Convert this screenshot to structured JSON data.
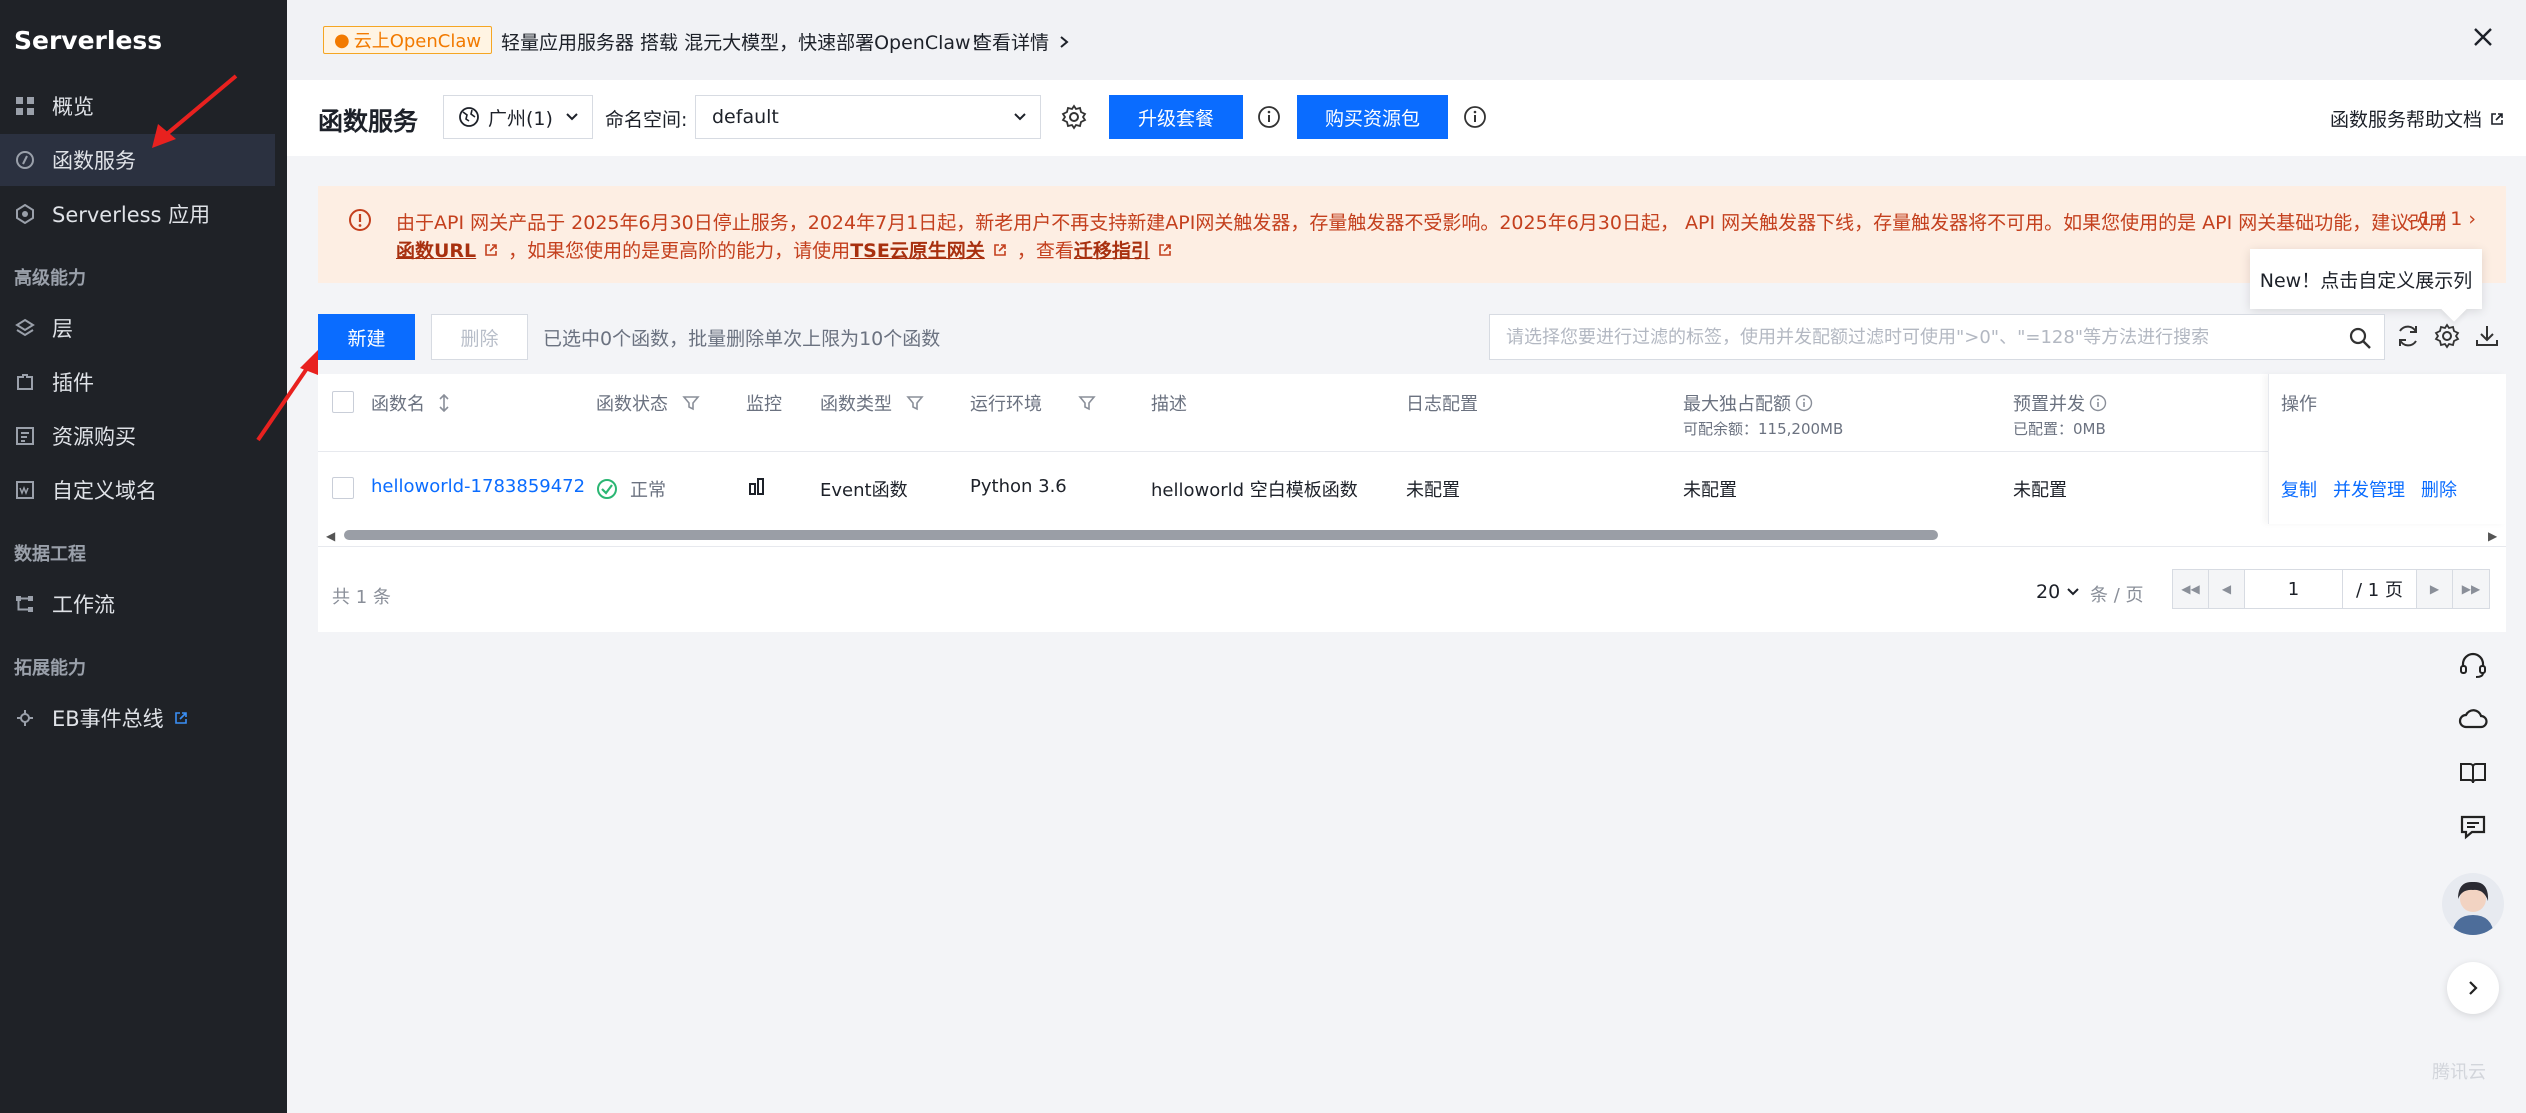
{
  "sidebar": {
    "title": "Serverless",
    "items": [
      {
        "label": "概览"
      },
      {
        "label": "函数服务"
      },
      {
        "label": "Serverless 应用"
      },
      {
        "label": "层"
      },
      {
        "label": "插件"
      },
      {
        "label": "资源购买"
      },
      {
        "label": "自定义域名"
      },
      {
        "label": "工作流"
      },
      {
        "label": "EB事件总线"
      }
    ],
    "sections": [
      "高级能力",
      "数据工程",
      "拓展能力"
    ]
  },
  "banner": {
    "tag": "云上OpenClaw",
    "text": "轻量应用服务器 搭载 混元大模型，快速部署OpenClaw！",
    "link": "查看详情"
  },
  "header": {
    "title": "函数服务",
    "region": "广州(1)",
    "namespace_label": "命名空间:",
    "namespace_value": "default",
    "upgrade_button": "升级套餐",
    "buy_button": "购买资源包",
    "help_link": "函数服务帮助文档"
  },
  "notice": {
    "line1": "由于API 网关产品于 2025年6月30日停止服务，2024年7月1日起，新老用户不再支持新建API网关触发器，存量触发器不受影响。2025年6月30日起， API 网关触发器下线，存量触发器将不可用。如果您使用的是 API 网关基础功能，建议改用",
    "link1": "函数URL",
    "mid": "，如果您使用的是更高阶的能力，请使用",
    "link2": "TSE云原生网关",
    "mid2": "，查看",
    "link3": "迁移指引",
    "pager": "1 / 1"
  },
  "tooltip": "New！点击自定义展示列",
  "toolbar": {
    "new_button": "新建",
    "delete_button": "删除",
    "selection_hint": "已选中0个函数，批量删除单次上限为10个函数",
    "search_placeholder": "请选择您要进行过滤的标签，使用并发配额过滤时可使用\">0\"、\"=128\"等方法进行搜索"
  },
  "table": {
    "columns": {
      "name": "函数名",
      "status": "函数状态",
      "monitor": "监控",
      "type": "函数类型",
      "runtime": "运行环境",
      "desc": "描述",
      "log": "日志配置",
      "quota": "最大独占配额",
      "quota_sub": "可配余额：115,200MB",
      "concurrency": "预置并发",
      "concurrency_sub": "已配置：0MB",
      "ops": "操作"
    },
    "rows": [
      {
        "name": "helloworld-1783859472",
        "status": "正常",
        "type": "Event函数",
        "runtime": "Python 3.6",
        "desc": "helloworld 空白模板函数",
        "log": "未配置",
        "quota": "未配置",
        "concurrency": "未配置",
        "ops": [
          "复制",
          "并发管理",
          "删除"
        ]
      }
    ],
    "total": "共 1 条",
    "page_size": "20",
    "page_size_unit": "条 / 页",
    "current_page": "1",
    "total_pages": "/ 1 页"
  },
  "watermark": "腾讯云",
  "colors": {
    "primary": "#0a6cff",
    "sidebar_bg": "#1f2227",
    "notice_bg": "#fdeee3",
    "notice_text": "#c4401e"
  }
}
